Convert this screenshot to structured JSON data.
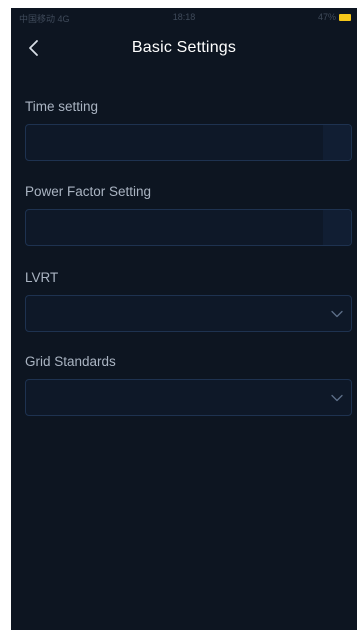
{
  "status_bar": {
    "carrier": "中国移动 4G",
    "time": "18:18",
    "battery": "47%"
  },
  "header": {
    "title": "Basic Settings"
  },
  "fields": [
    {
      "label": "Time setting",
      "value": ""
    },
    {
      "label": "Power Factor Setting",
      "value": ""
    },
    {
      "label": "LVRT",
      "selected": ""
    },
    {
      "label": "Grid Standards",
      "selected": ""
    }
  ],
  "colors": {
    "background": "#0d1521",
    "field_border": "#1e3250",
    "title": "#ffffff",
    "label": "#aab4c2",
    "battery": "#f5c71a"
  }
}
